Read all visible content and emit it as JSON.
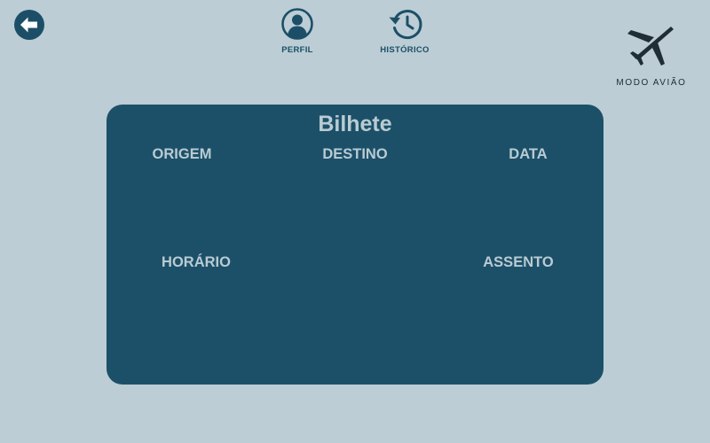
{
  "header": {
    "back_icon": "arrow-left-circle-icon",
    "nav": [
      {
        "label": "PERFIL",
        "icon": "user-circle-icon"
      },
      {
        "label": "HISTÓRICO",
        "icon": "history-clock-icon"
      }
    ],
    "logo": {
      "text": "MODO AVIÃO",
      "icon": "airplane-icon"
    }
  },
  "ticket": {
    "title": "Bilhete",
    "fields": {
      "origin": "ORIGEM",
      "destination": "DESTINO",
      "date": "DATA",
      "time": "HORÁRIO",
      "seat": "ASSENTO"
    }
  },
  "colors": {
    "background": "#bccdd5",
    "primary": "#1c5068",
    "card_text": "#b9cbd3",
    "logo": "#1f2d35"
  }
}
